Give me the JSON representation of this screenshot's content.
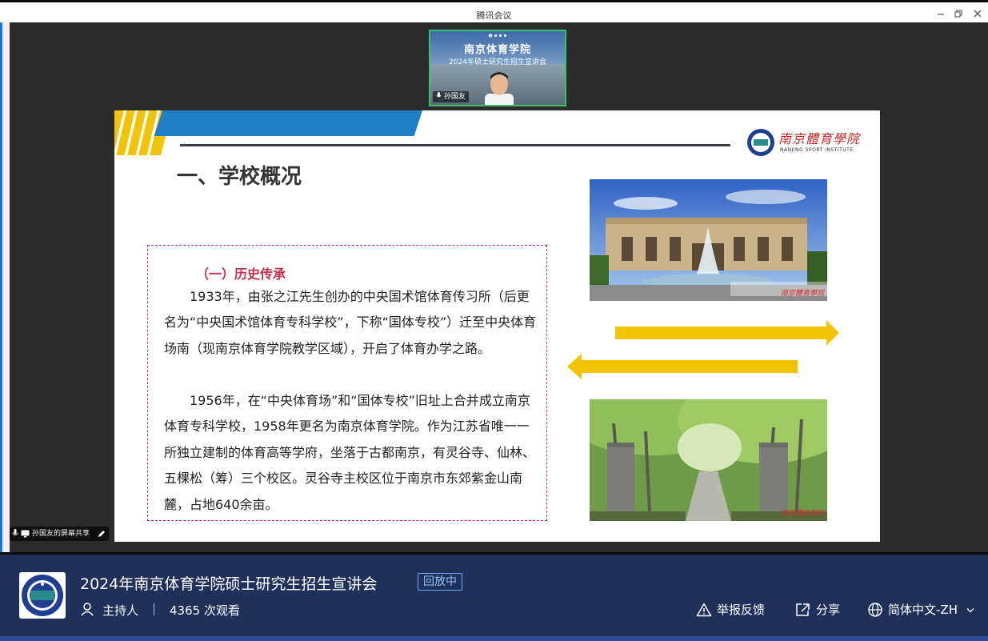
{
  "window": {
    "title": "腾讯会议"
  },
  "speaker": {
    "name": "孙国友",
    "backdrop_title": "南京体育学院",
    "backdrop_subtitle": "2024年硕士研究生招生宣讲会"
  },
  "slide": {
    "logo_cn": "南京體育學院",
    "logo_en": "NANJING SPORT INSTITUTE",
    "heading": "一、学校概况",
    "subheading": "（一）历史传承",
    "paragraphs": [
      "1933年，由张之江先生创办的中央国术馆体育传习所（后更名为“中央国术馆体育专科学校”，下称“国体专校”）迁至中央体育场南（现南京体育学院教学区域），开启了体育办学之路。",
      "1956年，在“中央体育场”和“国体专校”旧址上合并成立南京体育专科学校，1958年更名为南京体育学院。作为江苏省唯一一所独立建制的体育高等学府，坐落于古都南京，有灵谷寺、仙林、五棵松（筹）三个校区。灵谷寺主校区位于南京市东郊紫金山南麓，占地640余亩。"
    ],
    "photo_watermark": "南京體育學院"
  },
  "share": {
    "label": "孙国友的屏幕共享"
  },
  "footer": {
    "event_title": "2024年南京体育学院硕士研究生招生宣讲会",
    "status_badge": "回放中",
    "host_label": "主持人",
    "views": "4365 次观看",
    "report_label": "举报反馈",
    "share_label": "分享",
    "language_label": "简体中文-ZH"
  },
  "colors": {
    "accent_green": "#37c26b",
    "slide_red": "#c0344a",
    "slide_blue": "#1f7fc6",
    "arrow_yellow": "#f2c300",
    "footer_bg": "#20305a",
    "badge_blue": "#6aa8ff"
  },
  "icons": {
    "minimize": "minimize-icon",
    "restore": "restore-icon",
    "close": "close-icon",
    "mic": "microphone-icon",
    "screen": "screen-share-icon",
    "pen": "pen-icon",
    "user": "user-icon",
    "warning": "warning-icon",
    "share": "share-icon",
    "globe": "globe-icon",
    "chevron": "chevron-down-icon"
  }
}
